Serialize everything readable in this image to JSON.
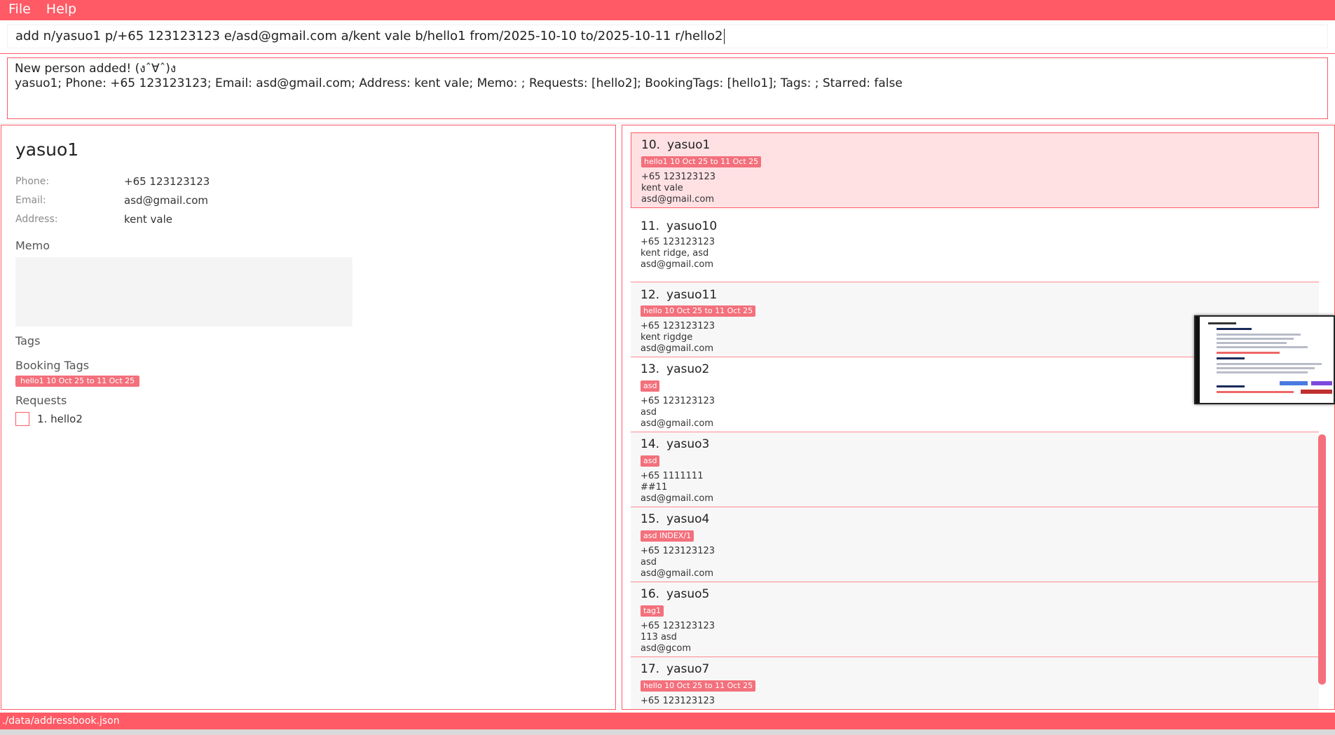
{
  "menu": {
    "file": "File",
    "help": "Help"
  },
  "command": {
    "value": "add n/yasuo1 p/+65 123123123 e/asd@gmail.com a/kent vale b/hello1 from/2025-10-10 to/2025-10-11 r/hello2"
  },
  "result": {
    "line1": "New person added! (งˆ∀ˆ)ง",
    "line2": "yasuo1; Phone: +65 123123123; Email: asd@gmail.com; Address: kent vale; Memo: ; Requests: [hello2]; BookingTags: [hello1]; Tags: ; Starred: false"
  },
  "detail": {
    "name": "yasuo1",
    "phone_label": "Phone:",
    "phone": "+65 123123123",
    "email_label": "Email:",
    "email": "asd@gmail.com",
    "address_label": "Address:",
    "address": "kent vale",
    "memo_title": "Memo",
    "tags_title": "Tags",
    "booking_title": "Booking Tags",
    "booking_tag": "hello1 10 Oct 25 to 11 Oct 25",
    "requests_title": "Requests",
    "request_1": "1. hello2"
  },
  "persons": [
    {
      "index": "10.",
      "name": "yasuo1",
      "tag": "hello1 10 Oct 25 to 11 Oct 25",
      "phone": "+65 123123123",
      "address": "kent vale",
      "email": "asd@gmail.com"
    },
    {
      "index": "11.",
      "name": "yasuo10",
      "tag": "",
      "phone": "+65 123123123",
      "address": "kent ridge, asd",
      "email": "asd@gmail.com"
    },
    {
      "index": "12.",
      "name": "yasuo11",
      "tag": "hello 10 Oct 25 to 11 Oct 25",
      "phone": "+65 123123123",
      "address": "kent rigdge",
      "email": "asd@gmail.com"
    },
    {
      "index": "13.",
      "name": "yasuo2",
      "tag": "asd",
      "phone": "+65 123123123",
      "address": "asd",
      "email": "asd@gmail.com"
    },
    {
      "index": "14.",
      "name": "yasuo3",
      "tag": "asd",
      "phone": "+65 1111111",
      "address": "##11",
      "email": "asd@gmail.com"
    },
    {
      "index": "15.",
      "name": "yasuo4",
      "tag": "asd INDEX/1",
      "phone": "+65 123123123",
      "address": "asd",
      "email": "asd@gmail.com"
    },
    {
      "index": "16.",
      "name": "yasuo5",
      "tag": "tag1",
      "phone": "+65 123123123",
      "address": "113 asd",
      "email": "asd@gcom"
    },
    {
      "index": "17.",
      "name": "yasuo7",
      "tag": "hello 10 Oct 25 to 11 Oct 25",
      "phone": "+65 123123123",
      "address": "",
      "email": ""
    }
  ],
  "status": {
    "path": "./data/addressbook.json"
  },
  "colors": {
    "accent": "#ff5a65",
    "tag": "#f3707c",
    "selected": "#ffe1e4"
  }
}
